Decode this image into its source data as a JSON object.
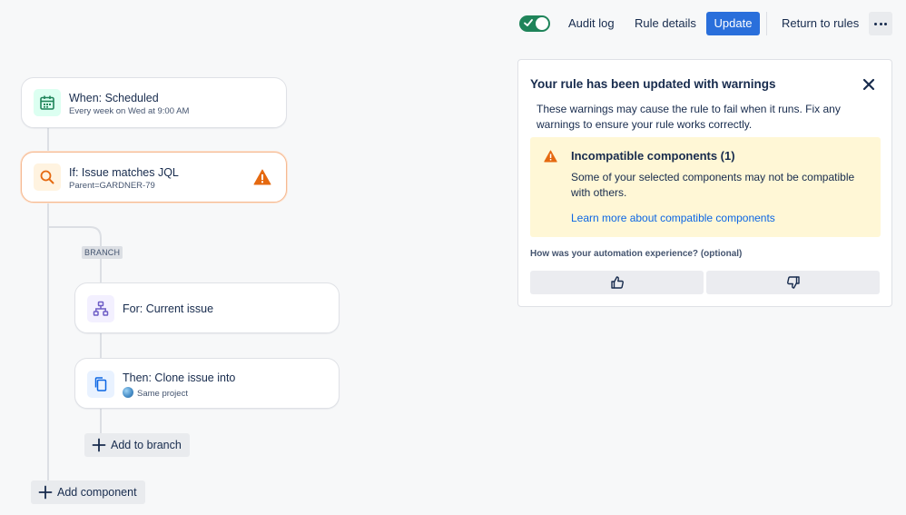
{
  "topbar": {
    "toggle_on": true,
    "audit_log": "Audit log",
    "rule_details": "Rule details",
    "update": "Update",
    "return_to_rules": "Return to rules",
    "more_icon": "more-horizontal-icon"
  },
  "flow": {
    "trigger": {
      "title": "When: Scheduled",
      "subtitle": "Every week on Wed at 9:00 AM",
      "icon": "calendar-icon"
    },
    "condition": {
      "title": "If: Issue matches JQL",
      "subtitle": "Parent=GARDNER-79",
      "icon": "search-icon",
      "warning": true
    },
    "branch_tag": "BRANCH",
    "branch": {
      "title": "For: Current issue",
      "icon": "hierarchy-icon"
    },
    "action": {
      "title": "Then: Clone issue into",
      "subtitle": "Same project",
      "icon": "copy-icon"
    },
    "add_to_branch": "Add to branch",
    "add_component": "Add component"
  },
  "panel": {
    "title": "Your rule has been updated with warnings",
    "description": "These warnings may cause the rule to fail when it runs. Fix any warnings to ensure your rule works correctly.",
    "warning": {
      "title": "Incompatible components (1)",
      "description": "Some of your selected components may not be compatible with others.",
      "link": "Learn more about compatible components"
    },
    "feedback_question": "How was your automation experience? (optional)"
  },
  "colors": {
    "primary": "#2a6fdb",
    "toggle_on": "#1f845a",
    "warning_icon": "#e56910",
    "warning_bg": "#fff7d6",
    "link": "#0c66e4"
  }
}
